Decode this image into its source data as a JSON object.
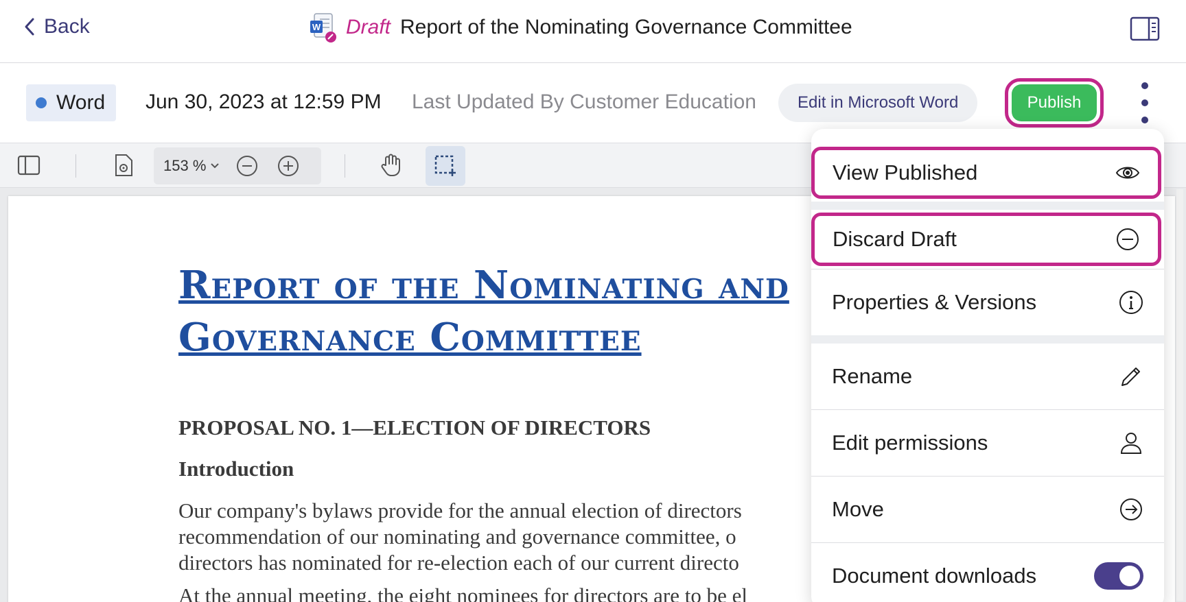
{
  "header": {
    "back_label": "Back",
    "draft_label": "Draft",
    "title": "Report of the Nominating Governance Committee"
  },
  "meta": {
    "file_type": "Word",
    "date": "Jun 30, 2023 at 12:59 PM",
    "last_updated": "Last Updated By Customer Education",
    "edit_button": "Edit in Microsoft Word",
    "publish_button": "Publish"
  },
  "toolbar": {
    "zoom": "153 %"
  },
  "document": {
    "heading_line1": "Report of the Nominating and",
    "heading_line2": "Governance Committee",
    "proposal": "PROPOSAL NO. 1—ELECTION OF DIRECTORS",
    "intro": "Introduction",
    "body_line1": "Our company's bylaws provide for the annual election of directors",
    "body_line2": "recommendation of our nominating and governance committee, o",
    "body_line3": "directors has nominated for re-election each of our current directo",
    "body_line4": "At the annual meeting, the eight nominees for directors are to be el"
  },
  "menu": {
    "items": [
      {
        "label": "View Published",
        "icon": "eye-icon"
      },
      {
        "label": "Discard Draft",
        "icon": "minus-circle-icon"
      },
      {
        "label": "Properties & Versions",
        "icon": "info-circle-icon"
      },
      {
        "label": "Rename",
        "icon": "pencil-icon"
      },
      {
        "label": "Edit permissions",
        "icon": "user-icon"
      },
      {
        "label": "Move",
        "icon": "arrow-right-circle-icon"
      },
      {
        "label": "Document downloads",
        "icon": "toggle"
      }
    ]
  },
  "colors": {
    "accent": "#3b3a78",
    "highlight": "#c2278a",
    "publish": "#3bbb5c",
    "heading": "#1f4e9e"
  }
}
